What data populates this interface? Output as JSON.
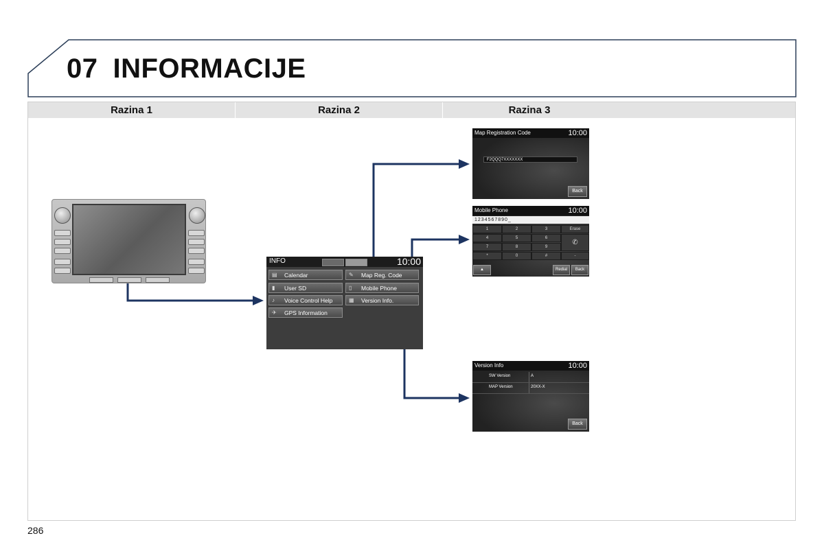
{
  "header": {
    "number": "07",
    "title": "INFORMACIJE"
  },
  "columns": [
    "Razina 1",
    "Razina 2",
    "Razina 3"
  ],
  "page_number": "286",
  "info_screen": {
    "title": "INFO",
    "time": "10:00",
    "left_items": [
      "Calendar",
      "User SD",
      "Voice Control Help",
      "GPS Information"
    ],
    "right_items": [
      "Map Reg. Code",
      "Mobile Phone",
      "Version Info."
    ]
  },
  "map_reg_screen": {
    "title": "Map Registration Code",
    "time": "10:00",
    "code": "F2QQQ7XXXXXXX",
    "back": "Back"
  },
  "mobile_screen": {
    "title": "Mobile Phone",
    "time": "10:00",
    "number": "1234567890_",
    "keys": [
      "1",
      "2",
      "3",
      "4",
      "5",
      "6",
      "7",
      "8",
      "9",
      "*",
      "0",
      "#"
    ],
    "erase": "Erase",
    "redial": "Redial",
    "back": "Back",
    "up": "▲"
  },
  "version_screen": {
    "title": "Version Info",
    "time": "10:00",
    "sw_label": "SW Version",
    "sw_value": "A",
    "map_label": "MAP Version",
    "map_value": "20XX-X",
    "back": "Back"
  },
  "colors": {
    "arrow": "#1d3461",
    "header_band": "#e3e3e3",
    "frame": "#2b3e58"
  }
}
